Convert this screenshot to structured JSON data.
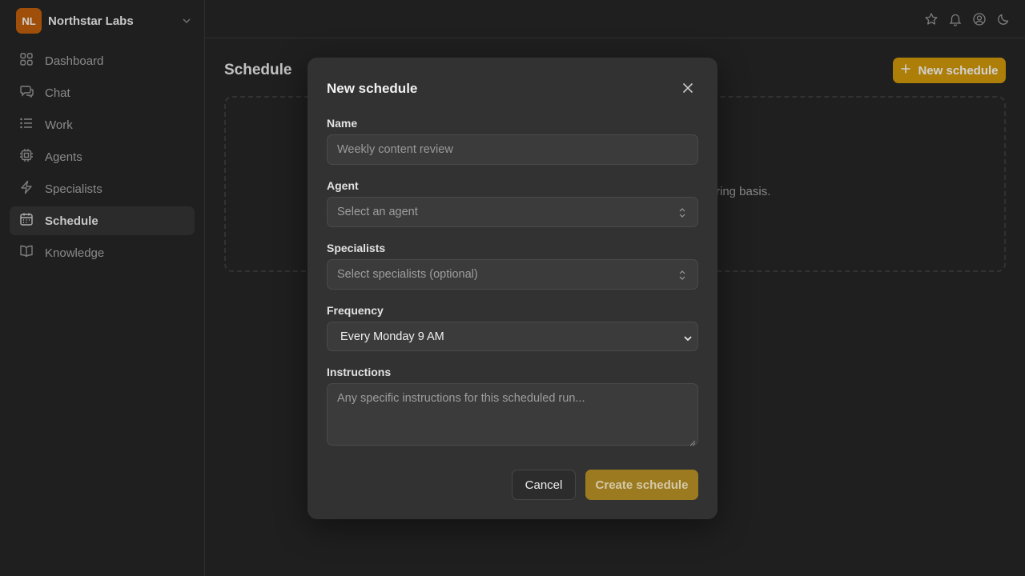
{
  "org": {
    "initials": "NL",
    "name": "Northstar Labs"
  },
  "sidebar": {
    "items": [
      {
        "label": "Dashboard",
        "icon": "dashboard-icon"
      },
      {
        "label": "Chat",
        "icon": "chat-icon"
      },
      {
        "label": "Work",
        "icon": "list-icon"
      },
      {
        "label": "Agents",
        "icon": "cpu-icon"
      },
      {
        "label": "Specialists",
        "icon": "lightning-icon"
      },
      {
        "label": "Schedule",
        "icon": "calendar-icon",
        "active": true
      },
      {
        "label": "Knowledge",
        "icon": "book-icon"
      }
    ]
  },
  "topbar": {
    "icons": [
      "star-icon",
      "bell-icon",
      "user-circle-icon",
      "moon-icon"
    ]
  },
  "main": {
    "title": "Schedule",
    "new_button": "New schedule",
    "empty_text": "ring basis."
  },
  "modal": {
    "title": "New schedule",
    "name": {
      "label": "Name",
      "placeholder": "Weekly content review"
    },
    "agent": {
      "label": "Agent",
      "placeholder": "Select an agent"
    },
    "specialists": {
      "label": "Specialists",
      "placeholder": "Select specialists (optional)"
    },
    "frequency": {
      "label": "Frequency",
      "value": "Every Monday 9 AM"
    },
    "instructions": {
      "label": "Instructions",
      "placeholder": "Any specific instructions for this scheduled run..."
    },
    "cancel": "Cancel",
    "create": "Create schedule"
  },
  "colors": {
    "accent": "#d49a0a",
    "org_avatar": "#c2610c",
    "create_disabled": "#9c7a1f"
  }
}
